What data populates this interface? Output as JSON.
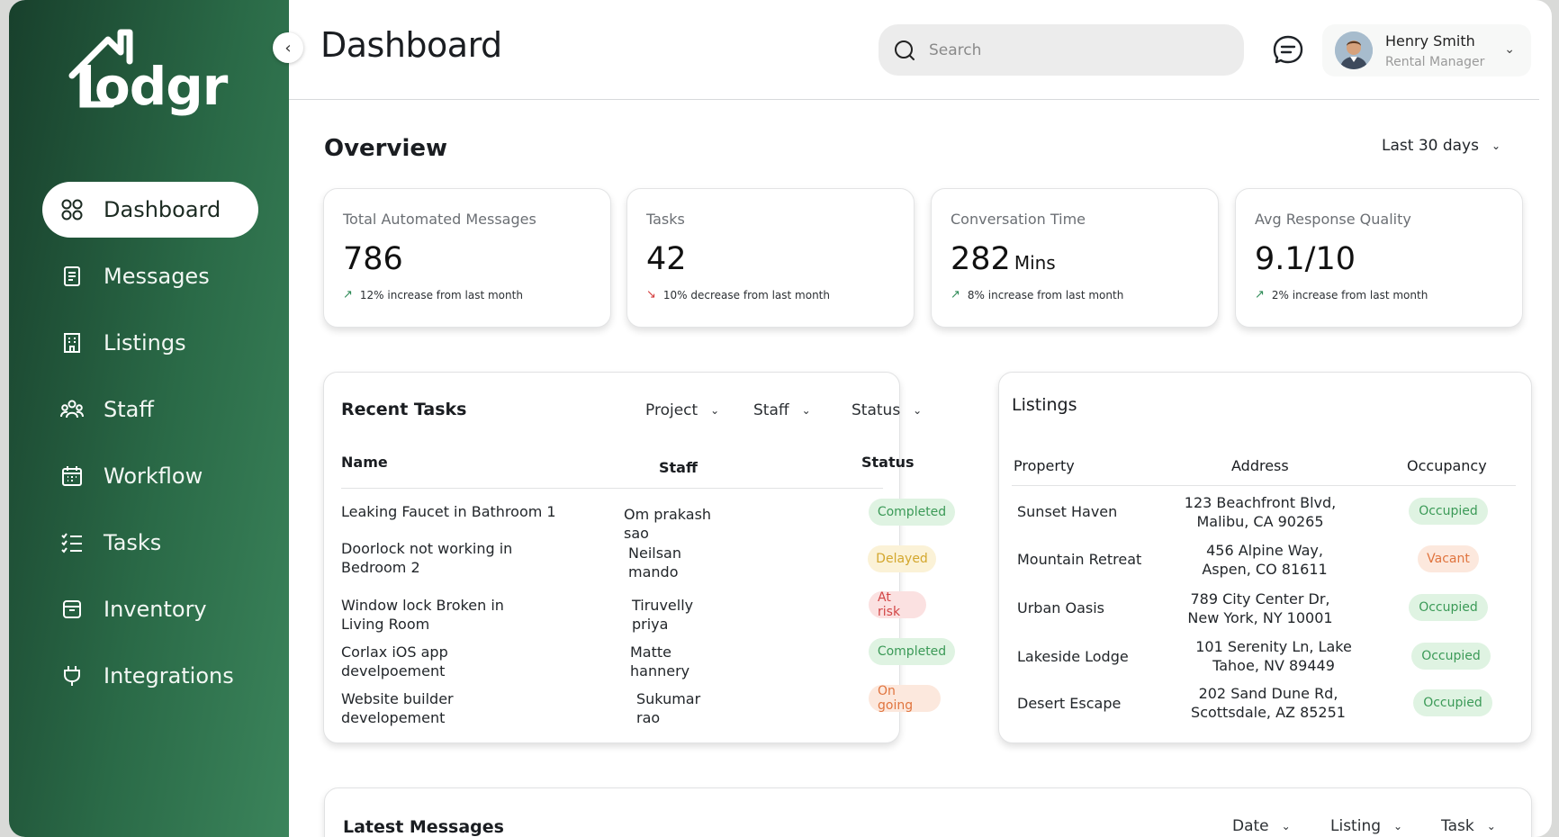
{
  "sidebar": {
    "logo_text": "lodgr",
    "items": [
      {
        "label": "Dashboard",
        "icon": "grid-icon",
        "active": true
      },
      {
        "label": "Messages",
        "icon": "document-icon"
      },
      {
        "label": "Listings",
        "icon": "building-icon"
      },
      {
        "label": "Staff",
        "icon": "people-icon"
      },
      {
        "label": "Workflow",
        "icon": "calendar-icon"
      },
      {
        "label": "Tasks",
        "icon": "checklist-icon"
      },
      {
        "label": "Inventory",
        "icon": "box-icon"
      },
      {
        "label": "Integrations",
        "icon": "plug-icon"
      }
    ]
  },
  "header": {
    "title": "Dashboard",
    "search_placeholder": "Search",
    "user_name": "Henry Smith",
    "user_role": "Rental Manager"
  },
  "overview": {
    "title": "Overview",
    "range": "Last 30 days",
    "cards": [
      {
        "label": "Total Automated Messages",
        "value": "786",
        "unit": "",
        "change": "12% increase from last month",
        "trend": "up"
      },
      {
        "label": "Tasks",
        "value": "42",
        "unit": "",
        "change": "10% decrease from last month",
        "trend": "down"
      },
      {
        "label": "Conversation Time",
        "value": "282",
        "unit": "Mins",
        "change": "8% increase from last month",
        "trend": "up"
      },
      {
        "label": "Avg Response Quality",
        "value": "9.1/10",
        "unit": "",
        "change": "2% increase from last month",
        "trend": "up"
      }
    ]
  },
  "recent_tasks": {
    "title": "Recent Tasks",
    "filters": [
      "Project",
      "Staff",
      "Status"
    ],
    "columns": [
      "Name",
      "Staff",
      "Status"
    ],
    "rows": [
      {
        "name": "Leaking Faucet in Bathroom 1",
        "staff": "Om prakash\nsao",
        "status": "Completed",
        "tone": "green"
      },
      {
        "name": "Doorlock not working in\nBedroom 2",
        "staff": "Neilsan\nmando",
        "status": "Delayed",
        "tone": "yellow"
      },
      {
        "name": "Window lock Broken in\nLiving Room",
        "staff": "Tiruvelly\npriya",
        "status": "At risk",
        "tone": "red"
      },
      {
        "name": "Corlax iOS app\ndevelpoement",
        "staff": "Matte\nhannery",
        "status": "Completed",
        "tone": "green"
      },
      {
        "name": "Website builder\ndevelopement",
        "staff": "Sukumar\nrao",
        "status": "On going",
        "tone": "orange"
      }
    ]
  },
  "listings": {
    "title": "Listings",
    "columns": [
      "Property",
      "Address",
      "Occupancy"
    ],
    "rows": [
      {
        "property": "Sunset Haven",
        "address": "123 Beachfront Blvd,\nMalibu, CA 90265",
        "occupancy": "Occupied",
        "tone": "green"
      },
      {
        "property": "Mountain Retreat",
        "address": "456 Alpine Way,\nAspen, CO 81611",
        "occupancy": "Vacant",
        "tone": "orange"
      },
      {
        "property": "Urban Oasis",
        "address": "789 City Center Dr,\nNew York, NY 10001",
        "occupancy": "Occupied",
        "tone": "green"
      },
      {
        "property": "Lakeside Lodge",
        "address": "101 Serenity Ln, Lake\nTahoe, NV 89449",
        "occupancy": "Occupied",
        "tone": "green"
      },
      {
        "property": "Desert Escape",
        "address": "202 Sand Dune Rd,\nScottsdale, AZ 85251",
        "occupancy": "Occupied",
        "tone": "green"
      }
    ]
  },
  "latest_messages": {
    "title": "Latest Messages",
    "filters": [
      "Date",
      "Listing",
      "Task"
    ]
  },
  "colors": {
    "sidebar_dark": "#18402c",
    "sidebar_light": "#3b845b",
    "status_green": "#3b9a57",
    "status_yellow": "#d3a72d",
    "status_red": "#d24646",
    "status_orange": "#e0743e"
  }
}
